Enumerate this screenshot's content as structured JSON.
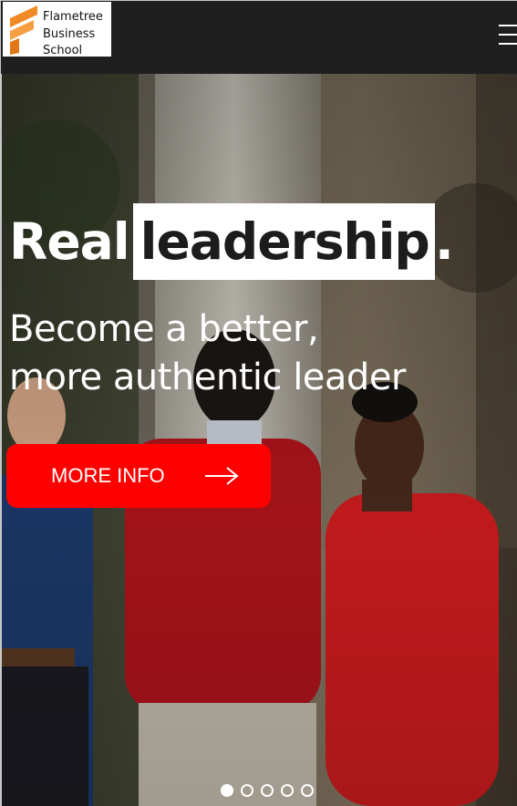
{
  "header": {
    "logo": {
      "lines": [
        "Flametree",
        "Business",
        "School"
      ]
    },
    "menu_icon": "hamburger-menu-icon"
  },
  "hero": {
    "headline_plain": "Real",
    "headline_highlight": "leadership",
    "headline_end": ".",
    "subhead_lines": [
      "Become a better,",
      "more authentic leader"
    ],
    "cta_label": "MORE INFO",
    "cta_icon": "arrow-right-icon",
    "slides": {
      "count": 5,
      "active": 1
    }
  },
  "colors": {
    "navbar": "#1f1f1f",
    "cta": "#ff0000",
    "logo_accent": "#f08a24"
  }
}
